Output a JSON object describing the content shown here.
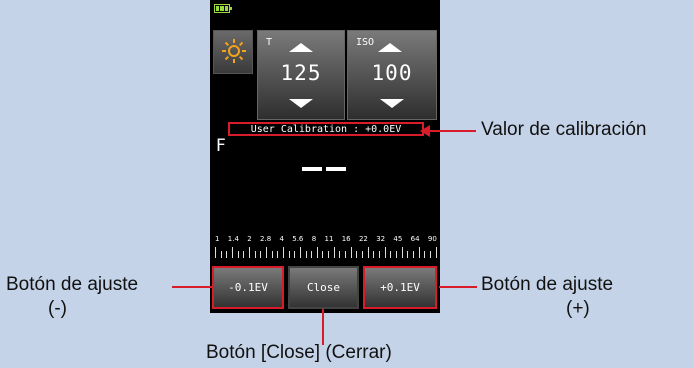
{
  "screen": {
    "t": {
      "label": "T",
      "value": "125"
    },
    "iso": {
      "label": "ISO",
      "value": "100"
    },
    "calibration": "User Calibration : +0.0EV",
    "f_label": "F",
    "f_scale": [
      "1",
      "1.4",
      "2",
      "2.8",
      "4",
      "5.6",
      "8",
      "11",
      "16",
      "22",
      "32",
      "45",
      "64",
      "90"
    ],
    "buttons": {
      "minus": "-0.1EV",
      "close": "Close",
      "plus": "+0.1EV"
    }
  },
  "annotations": {
    "calibration": "Valor de calibración",
    "minus_line1": "Botón de ajuste",
    "minus_line2": "(-)",
    "plus_line1": "Botón de ajuste",
    "plus_line2": "(+)",
    "close": "Botón [Close] (Cerrar)"
  },
  "colors": {
    "background": "#c5d3e8",
    "highlight": "#d91c2a",
    "battery": "#9adc3c"
  },
  "icons": {
    "battery": "battery-icon",
    "mode": "sun-icon"
  }
}
